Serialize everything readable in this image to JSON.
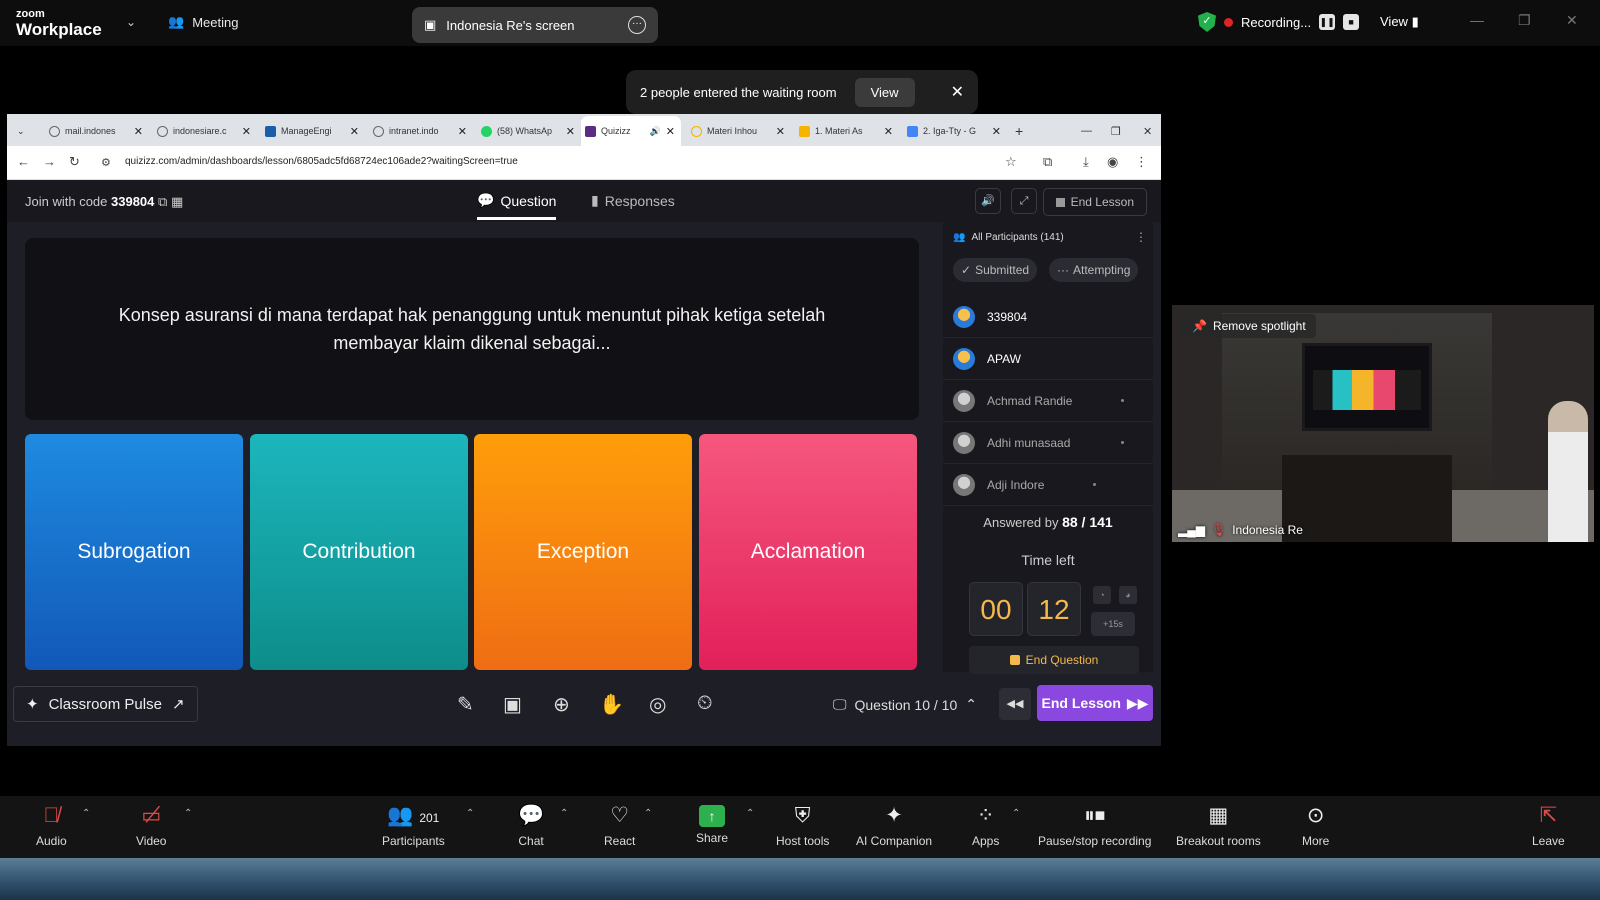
{
  "zoom": {
    "brand_small": "zoom",
    "brand_big": "Workplace",
    "meeting_label": "Meeting",
    "screen_share_label": "Indonesia Re's screen",
    "recording_label": "Recording...",
    "view_label": "View"
  },
  "notification": {
    "text": "2 people entered the waiting room",
    "view_button": "View"
  },
  "browser": {
    "tabs": [
      {
        "label": "mail.indones"
      },
      {
        "label": "indonesiare.c"
      },
      {
        "label": "ManageEngi"
      },
      {
        "label": "intranet.indo"
      },
      {
        "label": "(58) WhatsAp"
      },
      {
        "label": "Quizizz"
      },
      {
        "label": "Materi Inhou"
      },
      {
        "label": "1. Materi As"
      },
      {
        "label": "2. Iga-Tty - G"
      }
    ],
    "url": "quizizz.com/admin/dashboards/lesson/6805adc5fd68724ec106ade2?waitingScreen=true"
  },
  "quiz": {
    "join_label": "Join with code",
    "join_code": "339804",
    "tab_question": "Question",
    "tab_responses": "Responses",
    "end_lesson_top": "End Lesson",
    "question_text": "Konsep asuransi di mana terdapat hak penanggung untuk menuntut pihak ketiga setelah membayar klaim dikenal sebagai...",
    "options": [
      "Subrogation",
      "Contribution",
      "Exception",
      "Acclamation"
    ],
    "participants_header": "All Participants (141)",
    "filter_submitted": "Submitted",
    "filter_attempting": "Attempting",
    "participants": [
      {
        "name": "339804",
        "submitted": true
      },
      {
        "name": "APAW",
        "submitted": true
      },
      {
        "name": "Achmad Randie",
        "submitted": false
      },
      {
        "name": "Adhi munasaad",
        "submitted": false
      },
      {
        "name": "Adji Indore",
        "submitted": false
      }
    ],
    "answered_label": "Answered by",
    "answered_value": "88 / 141",
    "time_left_label": "Time left",
    "time_minutes": "00",
    "time_seconds": "12",
    "plus_time": "+15s",
    "end_question": "End Question",
    "classroom_pulse": "Classroom Pulse",
    "question_counter": "Question 10 / 10",
    "end_lesson_button": "End Lesson"
  },
  "video": {
    "remove_spotlight": "Remove spotlight",
    "participant_name": "Indonesia Re"
  },
  "toolbar": {
    "audio": "Audio",
    "video": "Video",
    "participants": "Participants",
    "participants_count": "201",
    "chat": "Chat",
    "react": "React",
    "share": "Share",
    "host_tools": "Host tools",
    "ai_companion": "AI Companion",
    "apps": "Apps",
    "pause_stop": "Pause/stop recording",
    "breakout": "Breakout rooms",
    "more": "More",
    "leave": "Leave"
  },
  "colors": {
    "option_blue": "#1e8be0",
    "option_teal": "#1cb6bd",
    "option_orange": "#ff9d0a",
    "option_pink": "#f5577e",
    "end_lesson_purple": "#8b48e0",
    "timer_text": "#f5b84a",
    "share_green": "#2fb04e"
  }
}
